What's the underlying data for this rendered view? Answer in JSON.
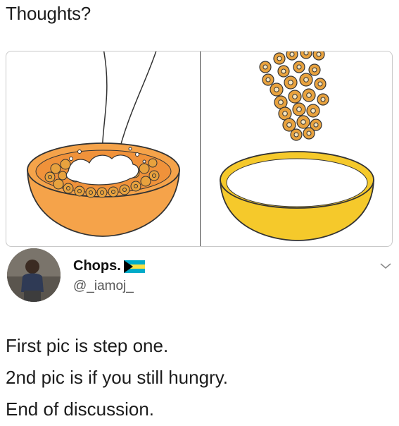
{
  "post": {
    "caption": "Thoughts?"
  },
  "tweet": {
    "display_name": "Chops.",
    "handle": "@_iamoj_",
    "flag_icon": "bahamas-flag-icon",
    "menu_icon": "chevron-down-icon",
    "lines": [
      "First pic is step one.",
      "2nd pic is if you still hungry.",
      "End of discussion."
    ]
  },
  "colors": {
    "orange_bowl": "#f5a34a",
    "yellow_bowl": "#f5c92b",
    "cereal": "#e8a23e",
    "milk": "#ffffff"
  }
}
